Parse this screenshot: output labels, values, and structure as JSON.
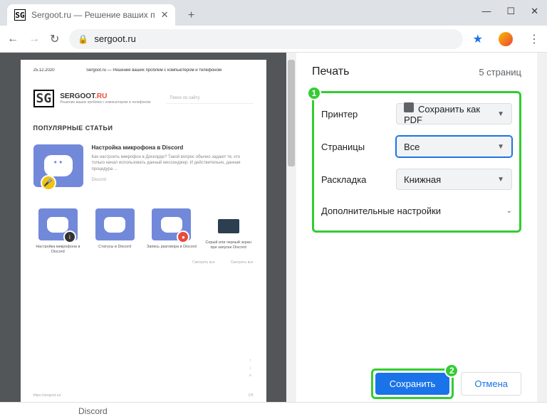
{
  "window": {
    "minimize": "—",
    "maximize": "☐",
    "close": "✕"
  },
  "tab": {
    "favicon": "SG",
    "title": "Sergoot.ru — Решение ваших п",
    "close": "✕",
    "new": "+"
  },
  "nav": {
    "back": "←",
    "forward": "→",
    "reload": "↻",
    "lock": "🔒",
    "url": "sergoot.ru",
    "star": "★",
    "menu": "⋮"
  },
  "preview": {
    "date": "25.12.2020",
    "header": "Sergoot.ru — Решение ваших проблем с компьютером и телефоном",
    "logo": "SG",
    "brand": "SERGOOT",
    "tld": ".RU",
    "tagline": "Решение ваших проблем с компьютером и телефоном",
    "search_ph": "Поиск по сайту",
    "popular": "ПОПУЛЯРНЫЕ СТАТЬИ",
    "main_article": {
      "title": "Настройка микрофона в Discord",
      "desc": "Как настроить микрофон в Дискорде? Такой вопрос обычно задают те, кто только начал использовать данный мессенджер. И действительно, данная процедура ...",
      "tag": "Discord"
    },
    "thumbs": [
      {
        "title": "Настройка микрофона в Discord"
      },
      {
        "title": "Статусы в Discord"
      },
      {
        "title": "Запись разговора в Discord"
      },
      {
        "title": "Серый или черный экран при запуске Discord"
      }
    ],
    "seemore": "Смотреть все",
    "footer_url": "https://sergoot.ru/",
    "footer_pg": "1/5"
  },
  "print": {
    "title": "Печать",
    "pages_info": "5 страниц",
    "printer_label": "Принтер",
    "printer_value": "Сохранить как PDF",
    "pages_label": "Страницы",
    "pages_value": "Все",
    "layout_label": "Раскладка",
    "layout_value": "Книжная",
    "more": "Дополнительные настройки",
    "save": "Сохранить",
    "cancel": "Отмена",
    "marker1": "1",
    "marker2": "2"
  },
  "bottom": "Discord"
}
